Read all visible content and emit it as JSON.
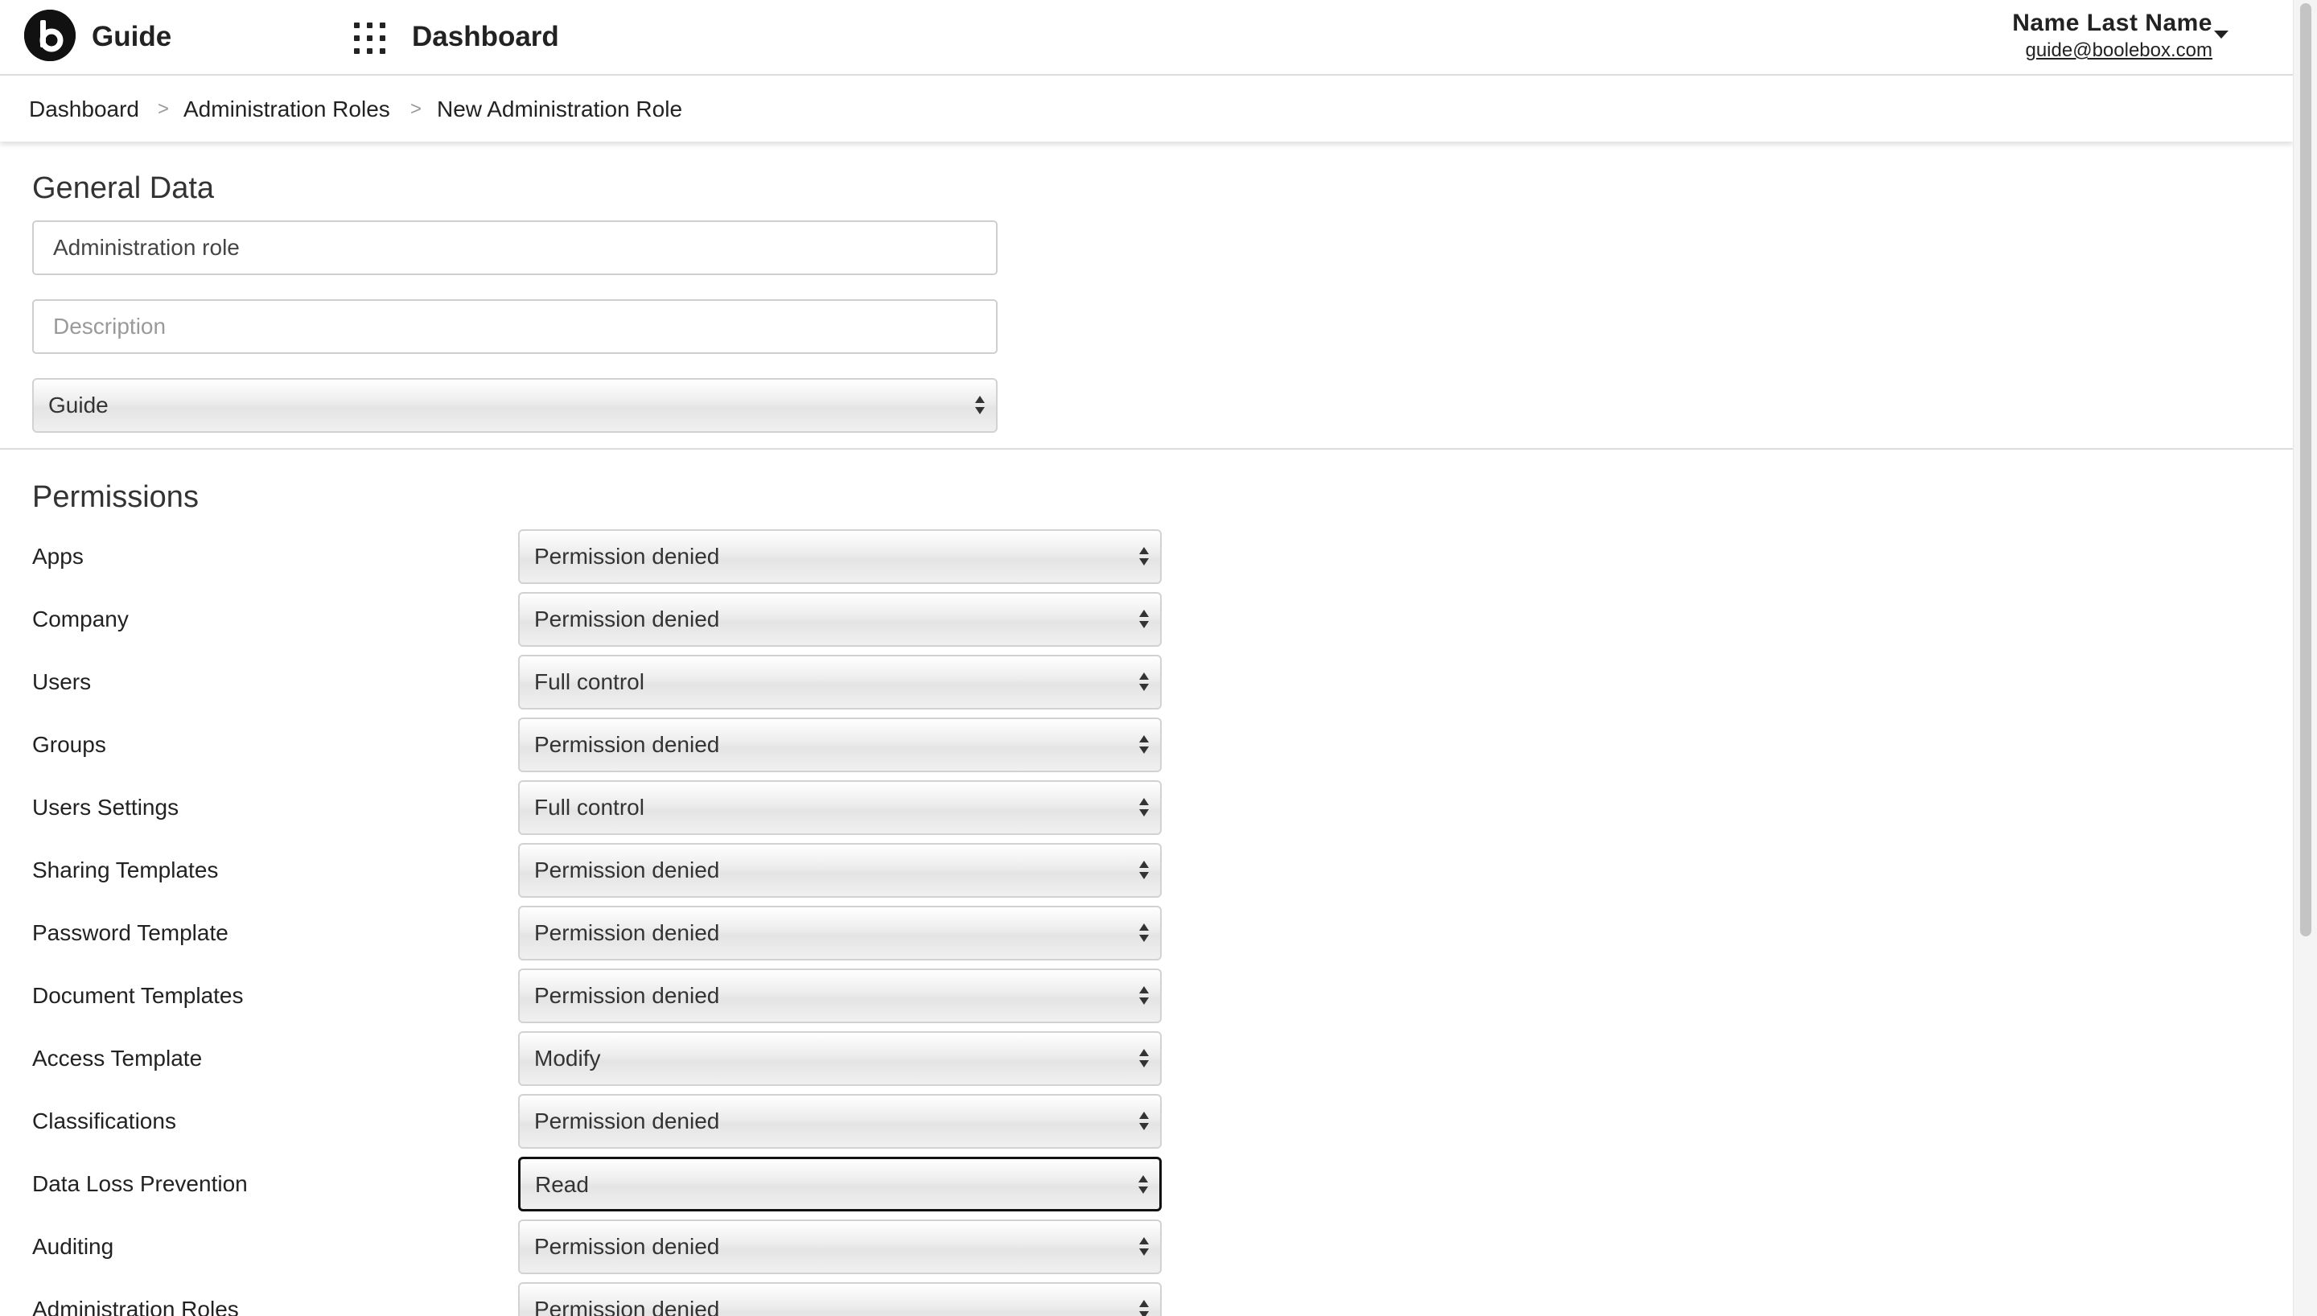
{
  "header": {
    "app_name": "Guide",
    "title": "Dashboard",
    "user_name": "Name Last Name",
    "user_email": "guide@boolebox.com"
  },
  "breadcrumb": [
    "Dashboard",
    "Administration Roles",
    "New Administration Role"
  ],
  "breadcrumb_separator": ">",
  "general": {
    "title": "General Data",
    "name_value": "Administration role",
    "description_placeholder": "Description",
    "type_value": "Guide"
  },
  "permissions": {
    "title": "Permissions",
    "rows": [
      {
        "label": "Apps",
        "value": "Permission denied"
      },
      {
        "label": "Company",
        "value": "Permission denied"
      },
      {
        "label": "Users",
        "value": "Full control"
      },
      {
        "label": "Groups",
        "value": "Permission denied"
      },
      {
        "label": "Users Settings",
        "value": "Full control"
      },
      {
        "label": "Sharing Templates",
        "value": "Permission denied"
      },
      {
        "label": "Password Template",
        "value": "Permission denied"
      },
      {
        "label": "Document Templates",
        "value": "Permission denied"
      },
      {
        "label": "Access Template",
        "value": "Modify"
      },
      {
        "label": "Classifications",
        "value": "Permission denied"
      },
      {
        "label": "Data Loss Prevention",
        "value": "Read"
      },
      {
        "label": "Auditing",
        "value": "Permission denied"
      },
      {
        "label": "Administration Roles",
        "value": "Permission denied"
      }
    ]
  },
  "colors": {
    "text": "#222222",
    "focus_border": "#111111",
    "divider": "#dcdcdc"
  },
  "icons": [
    "boolebox-logo-icon",
    "apps-grid-icon",
    "caret-down-icon",
    "select-arrows-icon"
  ]
}
